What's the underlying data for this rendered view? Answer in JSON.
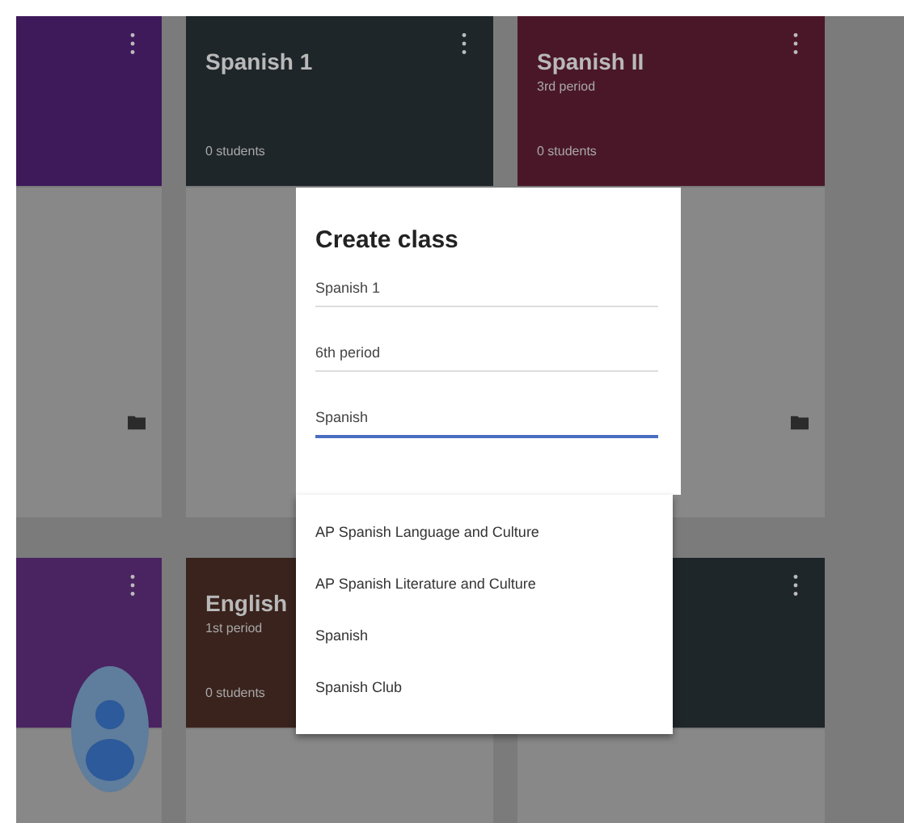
{
  "classes": [
    {
      "color": "#3e1a5a"
    },
    {
      "title": "Spanish 1",
      "students": "0 students",
      "color": "#1f2629"
    },
    {
      "title": "Spanish II",
      "section": "3rd period",
      "students": "0 students",
      "color": "#4a1729"
    },
    {
      "color": "#4a2361"
    },
    {
      "title": "English",
      "section": "1st period",
      "students": "0 students",
      "color": "#3a231d"
    },
    {
      "color": "#1f2629"
    }
  ],
  "dialog": {
    "title": "Create class",
    "fields": [
      {
        "value": "Spanish 1",
        "focused": false
      },
      {
        "value": "6th period",
        "focused": false
      },
      {
        "value": "Spanish",
        "focused": true
      }
    ]
  },
  "suggestions": [
    "AP Spanish Language and Culture",
    "AP Spanish Literature and Culture",
    "Spanish",
    "Spanish Club"
  ]
}
